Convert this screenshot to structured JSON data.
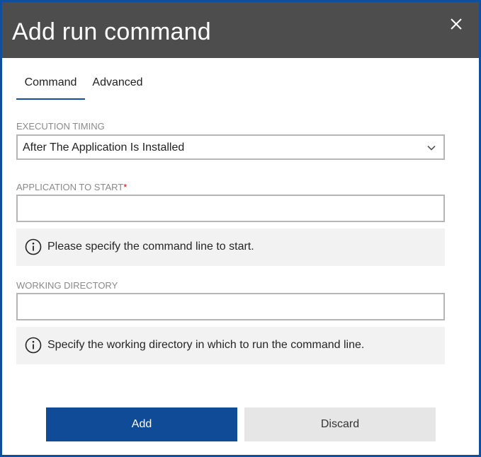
{
  "dialog": {
    "title": "Add run command",
    "close_icon": "close-icon"
  },
  "tabs": [
    {
      "label": "Command",
      "active": true
    },
    {
      "label": "Advanced",
      "active": false
    }
  ],
  "execution_timing": {
    "label": "EXECUTION TIMING",
    "value": "After The Application Is Installed",
    "icon": "chevron-down-icon"
  },
  "application_to_start": {
    "label": "APPLICATION TO START",
    "required_marker": "*",
    "value": "",
    "info_icon": "info-icon",
    "hint": "Please specify the command line to start."
  },
  "working_directory": {
    "label": "WORKING DIRECTORY",
    "value": "",
    "info_icon": "info-icon",
    "hint": "Specify the working directory in which to run the command line."
  },
  "buttons": {
    "add_label": "Add",
    "discard_label": "Discard"
  },
  "colors": {
    "title_bar": "#4d4d4d",
    "accent": "#0f4b96",
    "border": "#0f4f9c",
    "required": "#d40000",
    "info_background": "#f2f2f2",
    "secondary_button": "#e6e6e6"
  }
}
